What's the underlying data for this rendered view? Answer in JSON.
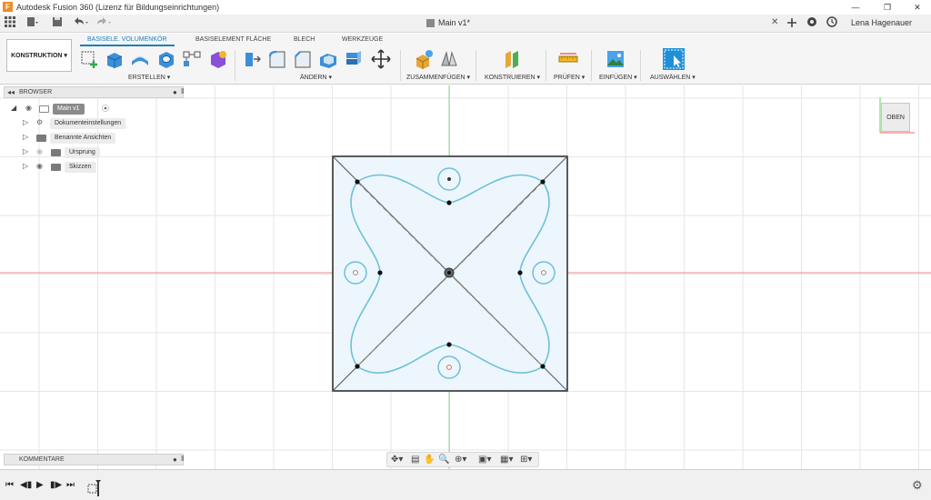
{
  "window": {
    "title": "Autodesk Fusion 360 (Lizenz für Bildungseinrichtungen)",
    "logo": "F",
    "controls": [
      "—",
      "❐",
      "✕"
    ]
  },
  "app_toolbar": {
    "doc_tab": "Main v1*",
    "close": "✕",
    "user": "Lena Hagenauer"
  },
  "ribbon": {
    "workspace": "KONSTRUKTION ▾",
    "tabs": [
      "BASISELE. VOLUMENKÖR",
      "BASISELEMENT FLÄCHE",
      "BLECH",
      "WERKZEUGE"
    ],
    "groups": [
      "ERSTELLEN ▾",
      "ÄNDERN ▾",
      "ZUSAMMENFÜGEN ▾",
      "KONSTRUIEREN ▾",
      "PRÜFEN ▾",
      "EINFÜGEN ▾",
      "AUSWÄHLEN ▾"
    ]
  },
  "browser": {
    "header": "BROWSER",
    "items": [
      {
        "label": "Main v1"
      },
      {
        "label": "Dokumenteinstellungen"
      },
      {
        "label": "Benannte Ansichten"
      },
      {
        "label": "Ursprung"
      },
      {
        "label": "Skizzen"
      }
    ]
  },
  "comments": {
    "label": "KOMMENTARE"
  },
  "viewcube": {
    "label": "OBEN"
  },
  "icons": {
    "grid": "app-grid-icon",
    "file": "file-icon",
    "save": "save-icon",
    "undo": "undo-icon",
    "redo": "redo-icon",
    "settings": "gear-icon"
  },
  "colors": {
    "accent": "#1a7fc0",
    "sketch_curve": "#6fc0da",
    "sketch_fill": "#edf6fc",
    "axis_x": "#e88a8a",
    "axis_y": "#8fd28f"
  }
}
